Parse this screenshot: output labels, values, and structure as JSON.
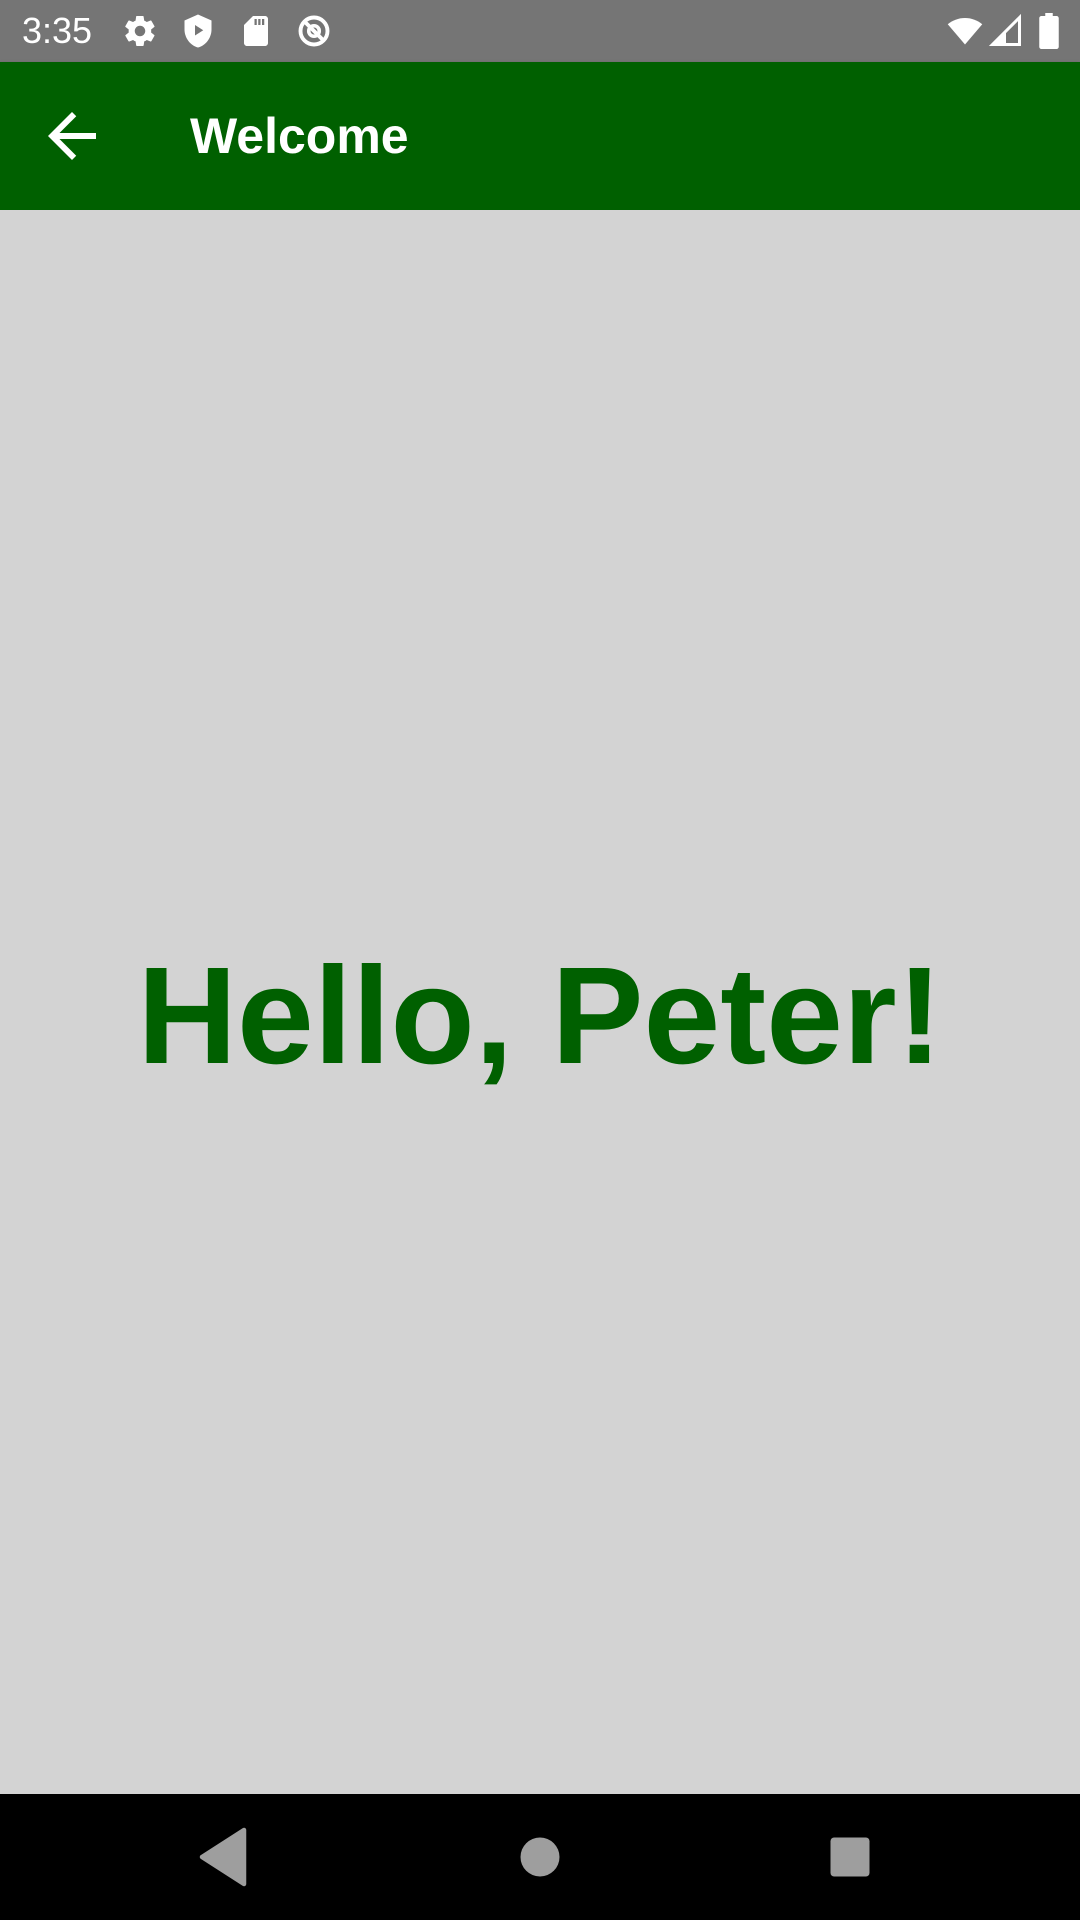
{
  "status_bar": {
    "time": "3:35",
    "left_icons": [
      "gear-icon",
      "play-shield-icon",
      "sd-card-icon",
      "no-sync-icon"
    ],
    "right_icons": [
      "wifi-icon",
      "cellular-signal-icon",
      "battery-icon"
    ]
  },
  "app_bar": {
    "title": "Welcome",
    "back_icon": "back-arrow-icon",
    "color": "#006000"
  },
  "main": {
    "greeting": "Hello, Peter!",
    "greeting_color": "#006000",
    "background": "#d3d3d3"
  },
  "nav_bar": {
    "buttons": [
      "back-triangle-icon",
      "home-circle-icon",
      "recents-square-icon"
    ]
  }
}
